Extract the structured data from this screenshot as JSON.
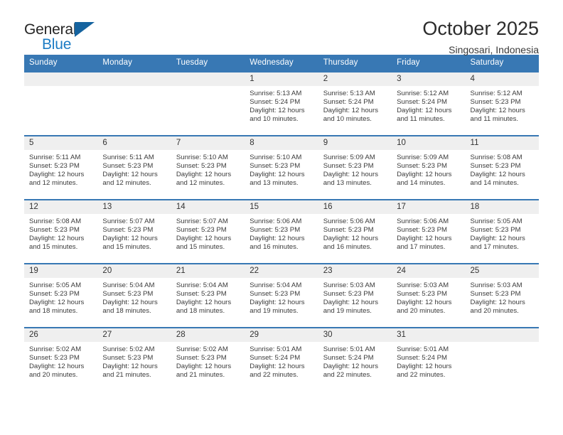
{
  "brand": {
    "name_line1": "General",
    "name_line2": "Blue",
    "triangle_color": "#15639f",
    "blue_text_color": "#1b7bc4"
  },
  "header": {
    "title": "October 2025",
    "location": "Singosari, Indonesia"
  },
  "theme": {
    "header_row_bg": "#3878b4",
    "header_row_text": "#ffffff",
    "daynum_band_bg": "#efefef",
    "row_divider": "#3878b4",
    "body_text": "#3b3b3b"
  },
  "labels": {
    "sunrise_prefix": "Sunrise:",
    "sunset_prefix": "Sunset:",
    "daylight_prefix": "Daylight:"
  },
  "weekday_headers": [
    "Sunday",
    "Monday",
    "Tuesday",
    "Wednesday",
    "Thursday",
    "Friday",
    "Saturday"
  ],
  "weeks": [
    [
      {
        "day": "",
        "sunrise": "",
        "sunset": "",
        "daylight": ""
      },
      {
        "day": "",
        "sunrise": "",
        "sunset": "",
        "daylight": ""
      },
      {
        "day": "",
        "sunrise": "",
        "sunset": "",
        "daylight": ""
      },
      {
        "day": "1",
        "sunrise": "Sunrise: 5:13 AM",
        "sunset": "Sunset: 5:24 PM",
        "daylight": "Daylight: 12 hours and 10 minutes."
      },
      {
        "day": "2",
        "sunrise": "Sunrise: 5:13 AM",
        "sunset": "Sunset: 5:24 PM",
        "daylight": "Daylight: 12 hours and 10 minutes."
      },
      {
        "day": "3",
        "sunrise": "Sunrise: 5:12 AM",
        "sunset": "Sunset: 5:24 PM",
        "daylight": "Daylight: 12 hours and 11 minutes."
      },
      {
        "day": "4",
        "sunrise": "Sunrise: 5:12 AM",
        "sunset": "Sunset: 5:23 PM",
        "daylight": "Daylight: 12 hours and 11 minutes."
      }
    ],
    [
      {
        "day": "5",
        "sunrise": "Sunrise: 5:11 AM",
        "sunset": "Sunset: 5:23 PM",
        "daylight": "Daylight: 12 hours and 12 minutes."
      },
      {
        "day": "6",
        "sunrise": "Sunrise: 5:11 AM",
        "sunset": "Sunset: 5:23 PM",
        "daylight": "Daylight: 12 hours and 12 minutes."
      },
      {
        "day": "7",
        "sunrise": "Sunrise: 5:10 AM",
        "sunset": "Sunset: 5:23 PM",
        "daylight": "Daylight: 12 hours and 12 minutes."
      },
      {
        "day": "8",
        "sunrise": "Sunrise: 5:10 AM",
        "sunset": "Sunset: 5:23 PM",
        "daylight": "Daylight: 12 hours and 13 minutes."
      },
      {
        "day": "9",
        "sunrise": "Sunrise: 5:09 AM",
        "sunset": "Sunset: 5:23 PM",
        "daylight": "Daylight: 12 hours and 13 minutes."
      },
      {
        "day": "10",
        "sunrise": "Sunrise: 5:09 AM",
        "sunset": "Sunset: 5:23 PM",
        "daylight": "Daylight: 12 hours and 14 minutes."
      },
      {
        "day": "11",
        "sunrise": "Sunrise: 5:08 AM",
        "sunset": "Sunset: 5:23 PM",
        "daylight": "Daylight: 12 hours and 14 minutes."
      }
    ],
    [
      {
        "day": "12",
        "sunrise": "Sunrise: 5:08 AM",
        "sunset": "Sunset: 5:23 PM",
        "daylight": "Daylight: 12 hours and 15 minutes."
      },
      {
        "day": "13",
        "sunrise": "Sunrise: 5:07 AM",
        "sunset": "Sunset: 5:23 PM",
        "daylight": "Daylight: 12 hours and 15 minutes."
      },
      {
        "day": "14",
        "sunrise": "Sunrise: 5:07 AM",
        "sunset": "Sunset: 5:23 PM",
        "daylight": "Daylight: 12 hours and 15 minutes."
      },
      {
        "day": "15",
        "sunrise": "Sunrise: 5:06 AM",
        "sunset": "Sunset: 5:23 PM",
        "daylight": "Daylight: 12 hours and 16 minutes."
      },
      {
        "day": "16",
        "sunrise": "Sunrise: 5:06 AM",
        "sunset": "Sunset: 5:23 PM",
        "daylight": "Daylight: 12 hours and 16 minutes."
      },
      {
        "day": "17",
        "sunrise": "Sunrise: 5:06 AM",
        "sunset": "Sunset: 5:23 PM",
        "daylight": "Daylight: 12 hours and 17 minutes."
      },
      {
        "day": "18",
        "sunrise": "Sunrise: 5:05 AM",
        "sunset": "Sunset: 5:23 PM",
        "daylight": "Daylight: 12 hours and 17 minutes."
      }
    ],
    [
      {
        "day": "19",
        "sunrise": "Sunrise: 5:05 AM",
        "sunset": "Sunset: 5:23 PM",
        "daylight": "Daylight: 12 hours and 18 minutes."
      },
      {
        "day": "20",
        "sunrise": "Sunrise: 5:04 AM",
        "sunset": "Sunset: 5:23 PM",
        "daylight": "Daylight: 12 hours and 18 minutes."
      },
      {
        "day": "21",
        "sunrise": "Sunrise: 5:04 AM",
        "sunset": "Sunset: 5:23 PM",
        "daylight": "Daylight: 12 hours and 18 minutes."
      },
      {
        "day": "22",
        "sunrise": "Sunrise: 5:04 AM",
        "sunset": "Sunset: 5:23 PM",
        "daylight": "Daylight: 12 hours and 19 minutes."
      },
      {
        "day": "23",
        "sunrise": "Sunrise: 5:03 AM",
        "sunset": "Sunset: 5:23 PM",
        "daylight": "Daylight: 12 hours and 19 minutes."
      },
      {
        "day": "24",
        "sunrise": "Sunrise: 5:03 AM",
        "sunset": "Sunset: 5:23 PM",
        "daylight": "Daylight: 12 hours and 20 minutes."
      },
      {
        "day": "25",
        "sunrise": "Sunrise: 5:03 AM",
        "sunset": "Sunset: 5:23 PM",
        "daylight": "Daylight: 12 hours and 20 minutes."
      }
    ],
    [
      {
        "day": "26",
        "sunrise": "Sunrise: 5:02 AM",
        "sunset": "Sunset: 5:23 PM",
        "daylight": "Daylight: 12 hours and 20 minutes."
      },
      {
        "day": "27",
        "sunrise": "Sunrise: 5:02 AM",
        "sunset": "Sunset: 5:23 PM",
        "daylight": "Daylight: 12 hours and 21 minutes."
      },
      {
        "day": "28",
        "sunrise": "Sunrise: 5:02 AM",
        "sunset": "Sunset: 5:23 PM",
        "daylight": "Daylight: 12 hours and 21 minutes."
      },
      {
        "day": "29",
        "sunrise": "Sunrise: 5:01 AM",
        "sunset": "Sunset: 5:24 PM",
        "daylight": "Daylight: 12 hours and 22 minutes."
      },
      {
        "day": "30",
        "sunrise": "Sunrise: 5:01 AM",
        "sunset": "Sunset: 5:24 PM",
        "daylight": "Daylight: 12 hours and 22 minutes."
      },
      {
        "day": "31",
        "sunrise": "Sunrise: 5:01 AM",
        "sunset": "Sunset: 5:24 PM",
        "daylight": "Daylight: 12 hours and 22 minutes."
      },
      {
        "day": "",
        "sunrise": "",
        "sunset": "",
        "daylight": ""
      }
    ]
  ]
}
